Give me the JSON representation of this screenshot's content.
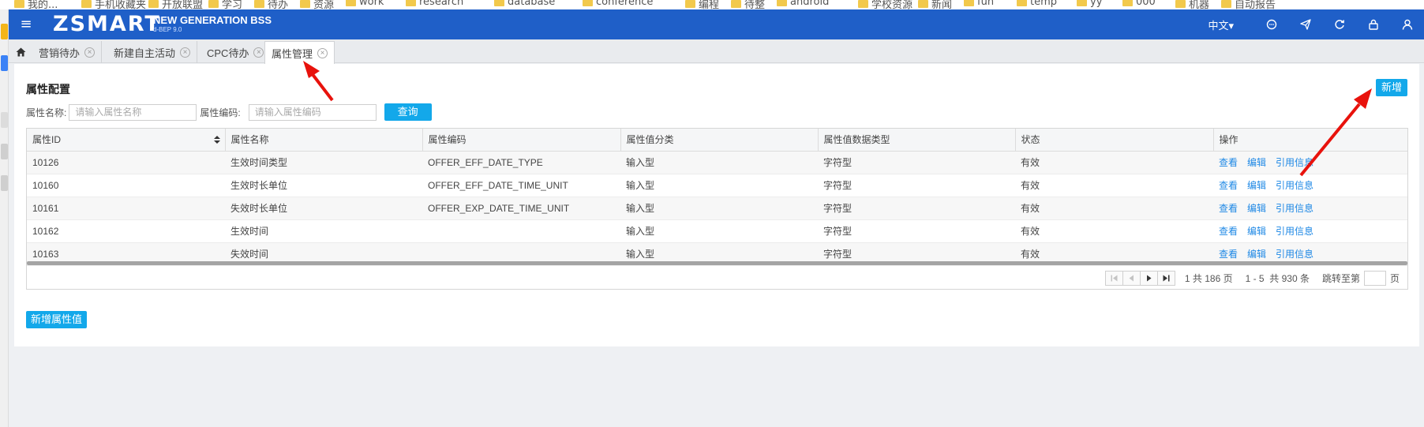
{
  "browser": {
    "bookmarks": [
      "我的...",
      "手机收藏夹",
      "开放联盟",
      "学习",
      "待办",
      "资源",
      "work",
      "research",
      "database",
      "conference",
      "编程",
      "待整",
      "android",
      "学校资源",
      "新闻",
      "fun",
      "temp",
      "yy",
      "000",
      "机器",
      "自动报告"
    ]
  },
  "navbar": {
    "menu_icon": "hamburger-icon",
    "brand": "ZSMART",
    "brand_sub": "NEW GENERATION BSS",
    "brand_version": "d-BEP 9.0",
    "language": "中文▾",
    "icons": [
      "chat-icon",
      "send-icon",
      "refresh-icon",
      "lock-icon",
      "user-icon"
    ],
    "bg_color": "#1f5fc8"
  },
  "tabs": {
    "home_icon": "home-icon",
    "items": [
      {
        "label": "营销待办"
      },
      {
        "label": "新建自主活动"
      },
      {
        "label": "CPC待办"
      },
      {
        "label": "属性管理"
      }
    ],
    "active_index": 3
  },
  "page": {
    "title": "属性配置",
    "add_button": "新增",
    "add_value_button": "新增属性值",
    "accent_color": "#13a8ea"
  },
  "search": {
    "name_label": "属性名称:",
    "name_placeholder": "请输入属性名称",
    "code_label": "属性编码:",
    "code_placeholder": "请输入属性编码",
    "query_button": "查询"
  },
  "table": {
    "columns": [
      "属性ID",
      "属性名称",
      "属性编码",
      "属性值分类",
      "属性值数据类型",
      "状态",
      "操作"
    ],
    "actions": [
      "查看",
      "编辑",
      "引用信息"
    ],
    "rows": [
      {
        "id": "10126",
        "name": "生效时间类型",
        "code": "OFFER_EFF_DATE_TYPE",
        "category": "输入型",
        "data_type": "字符型",
        "status": "有效"
      },
      {
        "id": "10160",
        "name": "生效时长单位",
        "code": "OFFER_EFF_DATE_TIME_UNIT",
        "category": "输入型",
        "data_type": "字符型",
        "status": "有效"
      },
      {
        "id": "10161",
        "name": "失效时长单位",
        "code": "OFFER_EXP_DATE_TIME_UNIT",
        "category": "输入型",
        "data_type": "字符型",
        "status": "有效"
      },
      {
        "id": "10162",
        "name": "生效时间",
        "code": "",
        "category": "输入型",
        "data_type": "字符型",
        "status": "有效"
      },
      {
        "id": "10163",
        "name": "失效时间",
        "code": "",
        "category": "输入型",
        "data_type": "字符型",
        "status": "有效"
      }
    ]
  },
  "pager": {
    "page_info": "1 共 186 页",
    "range_info": "1 - 5  共 930 条",
    "jump_label": "跳转至第",
    "page_unit": "页"
  },
  "annotation_color": "#e8120c"
}
